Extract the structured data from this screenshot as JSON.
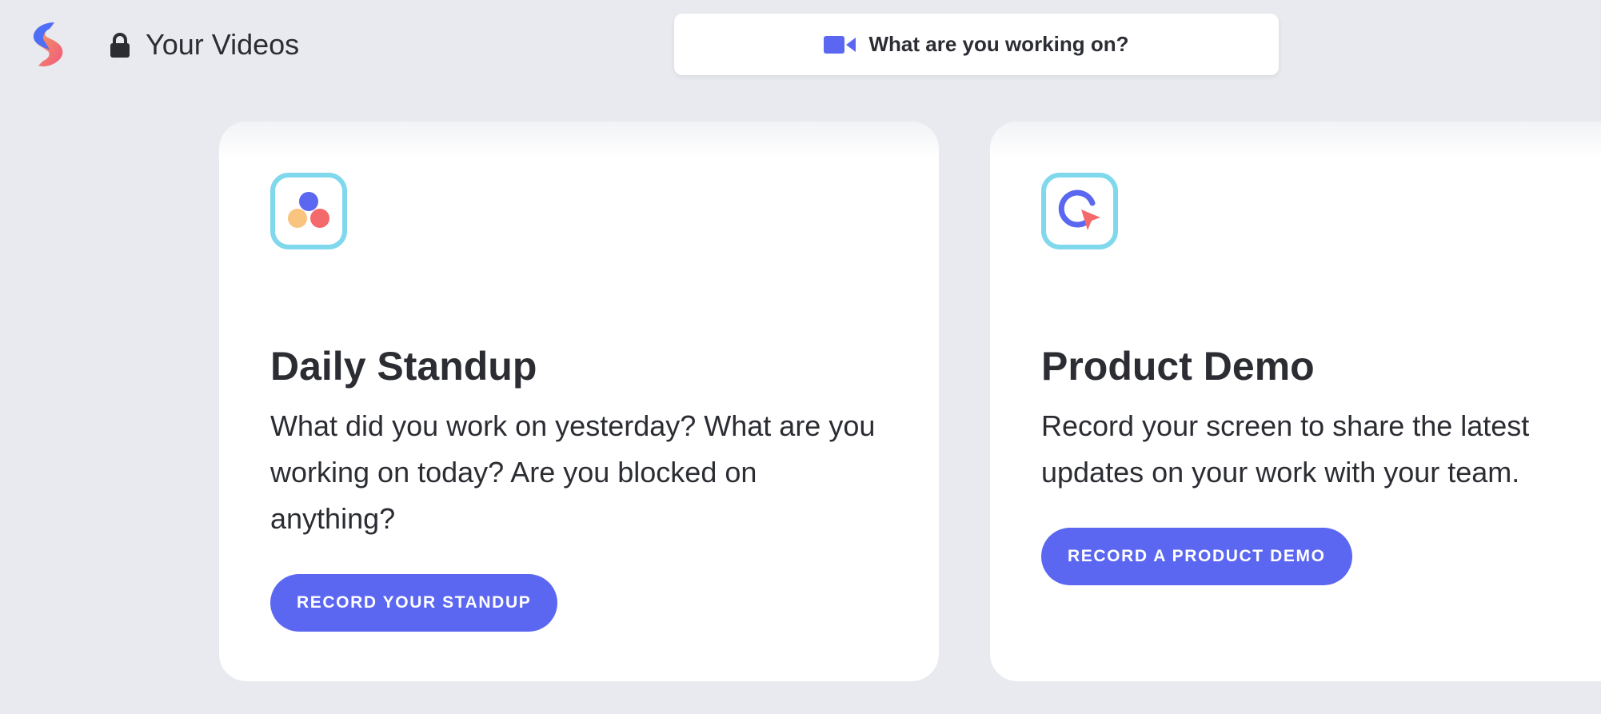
{
  "header": {
    "title": "Your Videos",
    "search_prompt": "What are you working on?"
  },
  "cards": [
    {
      "title": "Daily Standup",
      "description": "What did you work on yesterday? What are you working on today? Are you blocked on anything?",
      "button_label": "RECORD YOUR STANDUP",
      "icon": "three-dots-icon"
    },
    {
      "title": "Product Demo",
      "description": "Record your screen to share the latest updates on your work with your team.",
      "button_label": "RECORD A PRODUCT DEMO",
      "icon": "screen-record-cursor-icon"
    }
  ],
  "colors": {
    "background": "#e8eaef",
    "accent": "#5b67f1",
    "icon_border": "#7fd8ec",
    "icon_red": "#f4696b",
    "icon_yellow": "#f9c47f"
  }
}
